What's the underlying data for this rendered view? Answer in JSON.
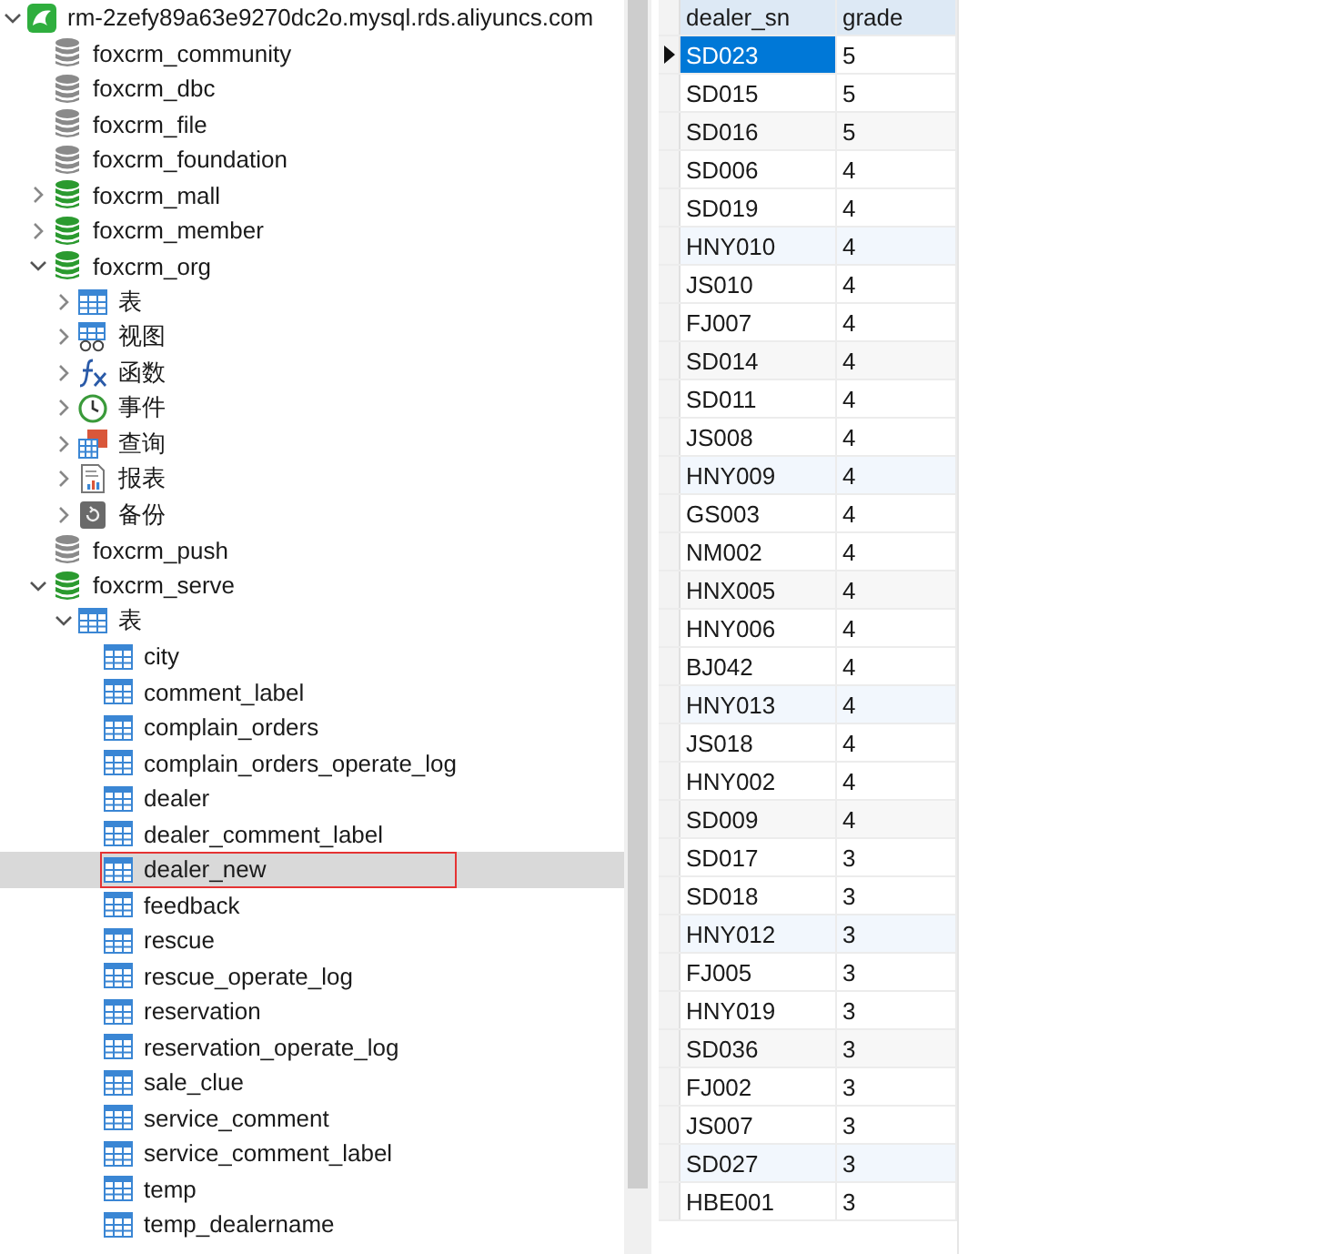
{
  "server": {
    "label": "rm-2zefy89a63e9270dc2o.mysql.rds.aliyuncs.com",
    "kind": "server",
    "expanded": true,
    "children": [
      {
        "label": "foxcrm_community",
        "kind": "database",
        "connected": false
      },
      {
        "label": "foxcrm_dbc",
        "kind": "database",
        "connected": false
      },
      {
        "label": "foxcrm_file",
        "kind": "database",
        "connected": false
      },
      {
        "label": "foxcrm_foundation",
        "kind": "database",
        "connected": false
      },
      {
        "label": "foxcrm_mall",
        "kind": "database",
        "connected": true,
        "expanded": false
      },
      {
        "label": "foxcrm_member",
        "kind": "database",
        "connected": true,
        "expanded": false
      },
      {
        "label": "foxcrm_org",
        "kind": "database",
        "connected": true,
        "expanded": true,
        "children": [
          {
            "label": "表",
            "kind": "tables",
            "expanded": false
          },
          {
            "label": "视图",
            "kind": "views",
            "expanded": false
          },
          {
            "label": "函数",
            "kind": "functions",
            "expanded": false
          },
          {
            "label": "事件",
            "kind": "events",
            "expanded": false
          },
          {
            "label": "查询",
            "kind": "queries",
            "expanded": false
          },
          {
            "label": "报表",
            "kind": "reports",
            "expanded": false
          },
          {
            "label": "备份",
            "kind": "backups",
            "expanded": false
          }
        ]
      },
      {
        "label": "foxcrm_push",
        "kind": "database",
        "connected": false
      },
      {
        "label": "foxcrm_serve",
        "kind": "database",
        "connected": true,
        "expanded": true,
        "children": [
          {
            "label": "表",
            "kind": "tables",
            "expanded": true,
            "children": [
              {
                "label": "city",
                "kind": "table",
                "selected": false
              },
              {
                "label": "comment_label",
                "kind": "table",
                "selected": false
              },
              {
                "label": "complain_orders",
                "kind": "table",
                "selected": false
              },
              {
                "label": "complain_orders_operate_log",
                "kind": "table",
                "selected": false
              },
              {
                "label": "dealer",
                "kind": "table",
                "selected": false
              },
              {
                "label": "dealer_comment_label",
                "kind": "table",
                "selected": false
              },
              {
                "label": "dealer_new",
                "kind": "table",
                "selected": true,
                "outlined": true
              },
              {
                "label": "feedback",
                "kind": "table",
                "selected": false
              },
              {
                "label": "rescue",
                "kind": "table",
                "selected": false
              },
              {
                "label": "rescue_operate_log",
                "kind": "table",
                "selected": false
              },
              {
                "label": "reservation",
                "kind": "table",
                "selected": false
              },
              {
                "label": "reservation_operate_log",
                "kind": "table",
                "selected": false
              },
              {
                "label": "sale_clue",
                "kind": "table",
                "selected": false
              },
              {
                "label": "service_comment",
                "kind": "table",
                "selected": false
              },
              {
                "label": "service_comment_label",
                "kind": "table",
                "selected": false
              },
              {
                "label": "temp",
                "kind": "table",
                "selected": false
              },
              {
                "label": "temp_dealername",
                "kind": "table",
                "selected": false
              }
            ]
          }
        ]
      }
    ]
  },
  "grid": {
    "columns": [
      "dealer_sn",
      "grade"
    ],
    "rows": [
      {
        "cells": [
          "SD023",
          "5"
        ],
        "selected": true
      },
      {
        "cells": [
          "SD015",
          "5"
        ],
        "selected": false
      },
      {
        "cells": [
          "SD016",
          "5"
        ],
        "selected": false
      },
      {
        "cells": [
          "SD006",
          "4"
        ],
        "selected": false
      },
      {
        "cells": [
          "SD019",
          "4"
        ],
        "selected": false
      },
      {
        "cells": [
          "HNY010",
          "4"
        ],
        "selected": false
      },
      {
        "cells": [
          "JS010",
          "4"
        ],
        "selected": false
      },
      {
        "cells": [
          "FJ007",
          "4"
        ],
        "selected": false
      },
      {
        "cells": [
          "SD014",
          "4"
        ],
        "selected": false
      },
      {
        "cells": [
          "SD011",
          "4"
        ],
        "selected": false
      },
      {
        "cells": [
          "JS008",
          "4"
        ],
        "selected": false
      },
      {
        "cells": [
          "HNY009",
          "4"
        ],
        "selected": false
      },
      {
        "cells": [
          "GS003",
          "4"
        ],
        "selected": false
      },
      {
        "cells": [
          "NM002",
          "4"
        ],
        "selected": false
      },
      {
        "cells": [
          "HNX005",
          "4"
        ],
        "selected": false
      },
      {
        "cells": [
          "HNY006",
          "4"
        ],
        "selected": false
      },
      {
        "cells": [
          "BJ042",
          "4"
        ],
        "selected": false
      },
      {
        "cells": [
          "HNY013",
          "4"
        ],
        "selected": false
      },
      {
        "cells": [
          "JS018",
          "4"
        ],
        "selected": false
      },
      {
        "cells": [
          "HNY002",
          "4"
        ],
        "selected": false
      },
      {
        "cells": [
          "SD009",
          "4"
        ],
        "selected": false
      },
      {
        "cells": [
          "SD017",
          "3"
        ],
        "selected": false
      },
      {
        "cells": [
          "SD018",
          "3"
        ],
        "selected": false
      },
      {
        "cells": [
          "HNY012",
          "3"
        ],
        "selected": false
      },
      {
        "cells": [
          "FJ005",
          "3"
        ],
        "selected": false
      },
      {
        "cells": [
          "HNY019",
          "3"
        ],
        "selected": false
      },
      {
        "cells": [
          "SD036",
          "3"
        ],
        "selected": false
      },
      {
        "cells": [
          "FJ002",
          "3"
        ],
        "selected": false
      },
      {
        "cells": [
          "JS007",
          "3"
        ],
        "selected": false
      },
      {
        "cells": [
          "SD027",
          "3"
        ],
        "selected": false
      },
      {
        "cells": [
          "HBE001",
          "3"
        ],
        "selected": false
      }
    ]
  }
}
